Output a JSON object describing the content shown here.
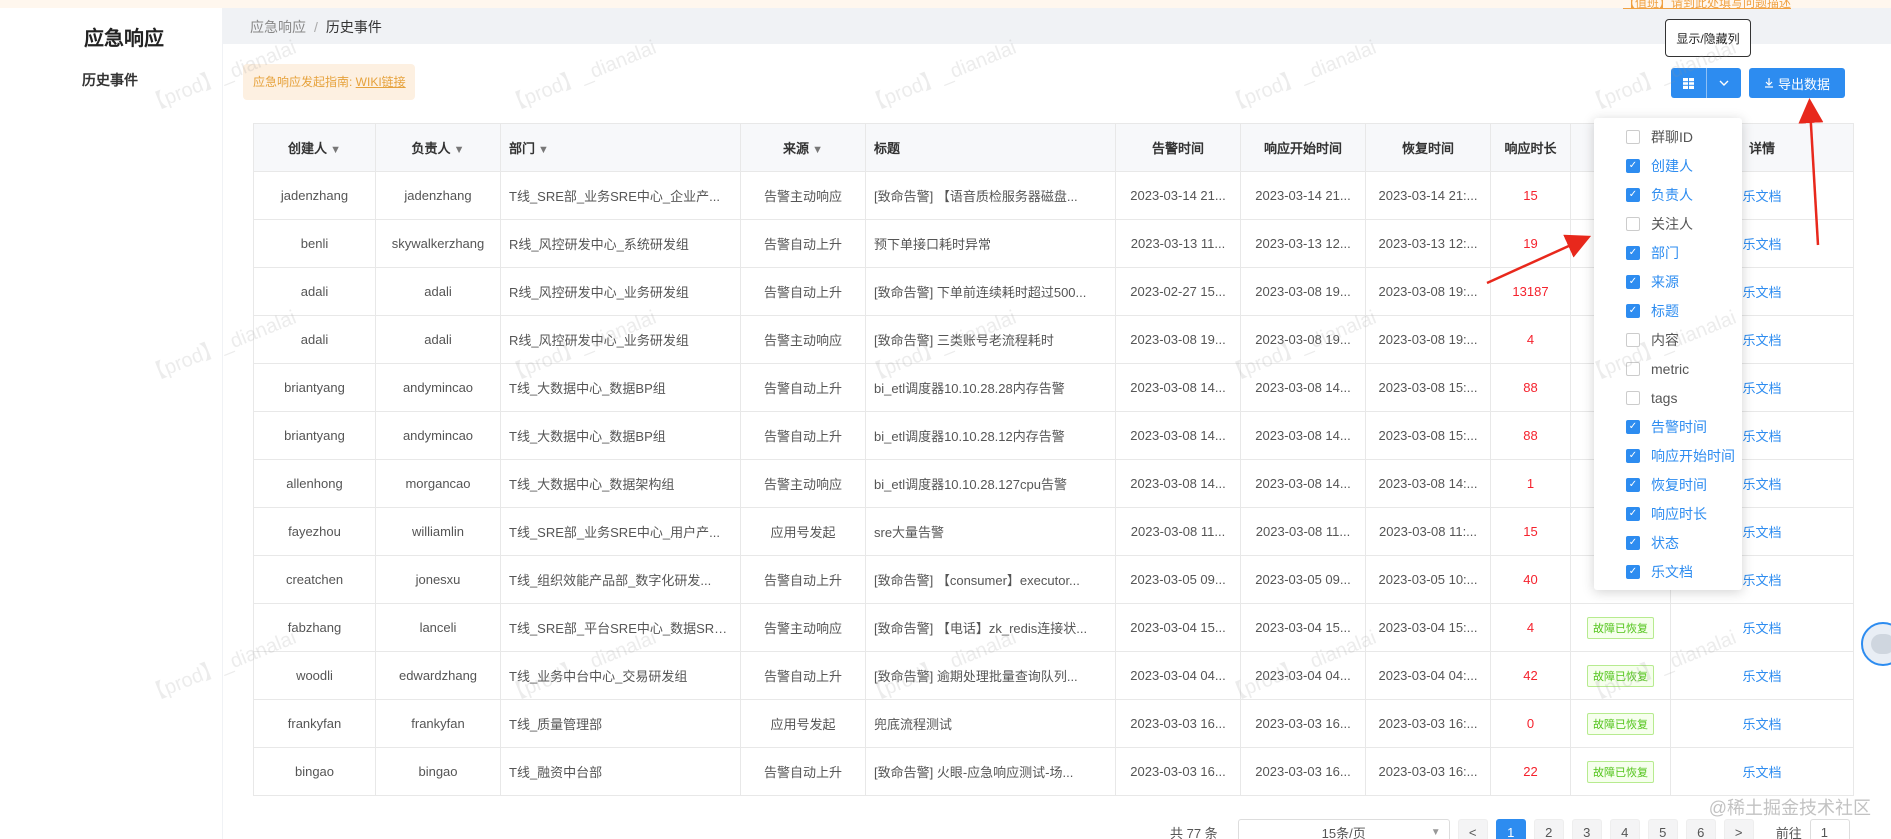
{
  "header": {
    "app_title": "应急响应",
    "top_link": "【值班】请到此处填写问题描述"
  },
  "breadcrumb": {
    "root": "应急响应",
    "separator": "/",
    "current": "历史事件"
  },
  "sidebar": {
    "items": [
      {
        "label": "历史事件"
      }
    ]
  },
  "guide": {
    "text": "应急响应发起指南: ",
    "link": "WIKI链接"
  },
  "toolbar": {
    "column_toggle_icon": "grid-icon",
    "column_toggle_tooltip": "显示/隐藏列",
    "export_label": "导出数据"
  },
  "table": {
    "headers": {
      "creator": "创建人",
      "owner": "负责人",
      "dept": "部门",
      "source": "来源",
      "title": "标题",
      "alert_time": "告警时间",
      "resp_start": "响应开始时间",
      "recover_time": "恢复时间",
      "duration": "响应时长",
      "detail": "详情"
    },
    "rows": [
      {
        "creator": "jadenzhang",
        "owner": "jadenzhang",
        "dept": "T线_SRE部_业务SRE中心_企业产...",
        "source": "告警主动响应",
        "title": "[致命告警] 【语音质检服务器磁盘...",
        "alert_time": "2023-03-14 21...",
        "resp_start": "2023-03-14 21...",
        "recover_time": "2023-03-14 21:...",
        "duration": "15",
        "status": "",
        "detail": "乐文档"
      },
      {
        "creator": "benli",
        "owner": "skywalkerzhang",
        "dept": "R线_风控研发中心_系统研发组",
        "source": "告警自动上升",
        "title": "预下单接口耗时异常",
        "alert_time": "2023-03-13 11...",
        "resp_start": "2023-03-13 12...",
        "recover_time": "2023-03-13 12:...",
        "duration": "19",
        "status": "",
        "detail": "乐文档"
      },
      {
        "creator": "adali",
        "owner": "adali",
        "dept": "R线_风控研发中心_业务研发组",
        "source": "告警自动上升",
        "title": "[致命告警] 下单前连续耗时超过500...",
        "alert_time": "2023-02-27 15...",
        "resp_start": "2023-03-08 19...",
        "recover_time": "2023-03-08 19:...",
        "duration": "13187",
        "status": "",
        "detail": "乐文档"
      },
      {
        "creator": "adali",
        "owner": "adali",
        "dept": "R线_风控研发中心_业务研发组",
        "source": "告警主动响应",
        "title": "[致命告警] 三类账号老流程耗时",
        "alert_time": "2023-03-08 19...",
        "resp_start": "2023-03-08 19...",
        "recover_time": "2023-03-08 19:...",
        "duration": "4",
        "status": "",
        "detail": "乐文档"
      },
      {
        "creator": "briantyang",
        "owner": "andymincao",
        "dept": "T线_大数据中心_数据BP组",
        "source": "告警自动上升",
        "title": "bi_etl调度器10.10.28.28内存告警",
        "alert_time": "2023-03-08 14...",
        "resp_start": "2023-03-08 14...",
        "recover_time": "2023-03-08 15:...",
        "duration": "88",
        "status": "",
        "detail": "乐文档"
      },
      {
        "creator": "briantyang",
        "owner": "andymincao",
        "dept": "T线_大数据中心_数据BP组",
        "source": "告警自动上升",
        "title": "bi_etl调度器10.10.28.12内存告警",
        "alert_time": "2023-03-08 14...",
        "resp_start": "2023-03-08 14...",
        "recover_time": "2023-03-08 15:...",
        "duration": "88",
        "status": "",
        "detail": "乐文档"
      },
      {
        "creator": "allenhong",
        "owner": "morgancao",
        "dept": "T线_大数据中心_数据架构组",
        "source": "告警主动响应",
        "title": "bi_etl调度器10.10.28.127cpu告警",
        "alert_time": "2023-03-08 14...",
        "resp_start": "2023-03-08 14...",
        "recover_time": "2023-03-08 14:...",
        "duration": "1",
        "status": "",
        "detail": "乐文档"
      },
      {
        "creator": "fayezhou",
        "owner": "williamlin",
        "dept": "T线_SRE部_业务SRE中心_用户产...",
        "source": "应用号发起",
        "title": "sre大量告警",
        "alert_time": "2023-03-08 11...",
        "resp_start": "2023-03-08 11...",
        "recover_time": "2023-03-08 11:...",
        "duration": "15",
        "status": "",
        "detail": "乐文档"
      },
      {
        "creator": "creatchen",
        "owner": "jonesxu",
        "dept": "T线_组织效能产品部_数字化研发...",
        "source": "告警自动上升",
        "title": "[致命告警] 【consumer】executor...",
        "alert_time": "2023-03-05 09...",
        "resp_start": "2023-03-05 09...",
        "recover_time": "2023-03-05 10:...",
        "duration": "40",
        "status": "",
        "detail": "乐文档"
      },
      {
        "creator": "fabzhang",
        "owner": "lanceli",
        "dept": "T线_SRE部_平台SRE中心_数据SRE...",
        "source": "告警主动响应",
        "title": "[致命告警] 【电话】zk_redis连接状...",
        "alert_time": "2023-03-04 15...",
        "resp_start": "2023-03-04 15...",
        "recover_time": "2023-03-04 15:...",
        "duration": "4",
        "status": "故障已恢复",
        "detail": "乐文档"
      },
      {
        "creator": "woodli",
        "owner": "edwardzhang",
        "dept": "T线_业务中台中心_交易研发组",
        "source": "告警自动上升",
        "title": "[致命告警] 逾期处理批量查询队列...",
        "alert_time": "2023-03-04 04...",
        "resp_start": "2023-03-04 04...",
        "recover_time": "2023-03-04 04:...",
        "duration": "42",
        "status": "故障已恢复",
        "detail": "乐文档"
      },
      {
        "creator": "frankyfan",
        "owner": "frankyfan",
        "dept": "T线_质量管理部",
        "source": "应用号发起",
        "title": "兜底流程测试",
        "alert_time": "2023-03-03 16...",
        "resp_start": "2023-03-03 16...",
        "recover_time": "2023-03-03 16:...",
        "duration": "0",
        "status": "故障已恢复",
        "detail": "乐文档"
      },
      {
        "creator": "bingao",
        "owner": "bingao",
        "dept": "T线_融资中台部",
        "source": "告警自动上升",
        "title": "[致命告警] 火眼-应急响应测试-场...",
        "alert_time": "2023-03-03 16...",
        "resp_start": "2023-03-03 16...",
        "recover_time": "2023-03-03 16:...",
        "duration": "22",
        "status": "故障已恢复",
        "detail": "乐文档"
      }
    ]
  },
  "column_menu": {
    "items": [
      {
        "label": "群聊ID",
        "checked": false
      },
      {
        "label": "创建人",
        "checked": true
      },
      {
        "label": "负责人",
        "checked": true
      },
      {
        "label": "关注人",
        "checked": false
      },
      {
        "label": "部门",
        "checked": true
      },
      {
        "label": "来源",
        "checked": true
      },
      {
        "label": "标题",
        "checked": true
      },
      {
        "label": "内容",
        "checked": false
      },
      {
        "label": "metric",
        "checked": false
      },
      {
        "label": "tags",
        "checked": false
      },
      {
        "label": "告警时间",
        "checked": true
      },
      {
        "label": "响应开始时间",
        "checked": true
      },
      {
        "label": "恢复时间",
        "checked": true
      },
      {
        "label": "响应时长",
        "checked": true
      },
      {
        "label": "状态",
        "checked": true
      },
      {
        "label": "乐文档",
        "checked": true
      }
    ]
  },
  "pagination": {
    "total": "共 77 条",
    "page_size": "15条/页",
    "prev": "<",
    "pages": [
      "1",
      "2",
      "3",
      "4",
      "5",
      "6"
    ],
    "current": "1",
    "next": ">",
    "goto_label": "前往",
    "goto_value": "1"
  },
  "watermark": {
    "text": "【prod】_dianalai"
  },
  "corner_watermark": "@稀土掘金技术社区",
  "colors": {
    "primary": "#2d8cf0",
    "danger": "#f5222d",
    "success": "#52c41a",
    "warning": "#e6a23c",
    "annotation_arrow": "#e8281c"
  }
}
